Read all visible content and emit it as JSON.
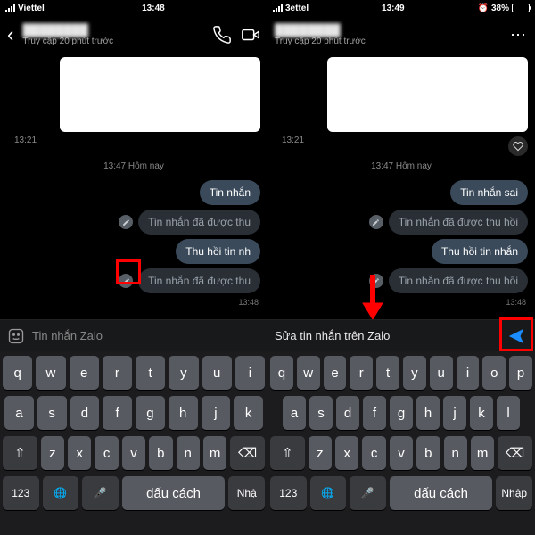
{
  "left": {
    "status": {
      "carrier": "Viettel",
      "time": "13:48"
    },
    "header": {
      "name": "████████",
      "sub": "Truy cập 20 phút trước"
    },
    "img_ts": "13:21",
    "center_ts": "13:47 Hôm nay",
    "msgs": [
      {
        "text": "Tin nhắn",
        "type": "normal"
      },
      {
        "text": "Tin nhắn đã được thu",
        "type": "recalled",
        "edit": true
      },
      {
        "text": "Thu hồi tin nh",
        "type": "normal"
      },
      {
        "text": "Tin nhắn đã được thu",
        "type": "recalled",
        "edit": true,
        "ts": "13:48"
      }
    ],
    "input": {
      "placeholder": "Tin nhắn Zalo"
    },
    "kb": {
      "r1": [
        "q",
        "w",
        "e",
        "r",
        "t",
        "y",
        "u",
        "i"
      ],
      "r2": [
        "a",
        "s",
        "d",
        "f",
        "g",
        "h",
        "j",
        "k"
      ],
      "r3": [
        "z",
        "x",
        "c",
        "v",
        "b",
        "n",
        "m"
      ],
      "num": "123",
      "space": "dấu cách",
      "ret": "Nhậ"
    }
  },
  "right": {
    "status": {
      "carrier": "3ettel",
      "time": "13:49",
      "batt": "38%"
    },
    "header": {
      "name": "████████",
      "sub": "Truy cập 20 phút trước"
    },
    "img_ts": "13:21",
    "center_ts": "13:47 Hôm nay",
    "msgs": [
      {
        "text": "Tin nhắn sai",
        "type": "normal"
      },
      {
        "text": "Tin nhắn đã được thu hồi",
        "type": "recalled",
        "edit": true
      },
      {
        "text": "Thu hồi tin nhắn",
        "type": "normal"
      },
      {
        "text": "Tin nhắn đã được thu hồi",
        "type": "recalled",
        "edit": true,
        "ts": "13:48"
      }
    ],
    "input": {
      "typed": "Sửa tin nhắn trên Zalo"
    },
    "kb": {
      "r1": [
        "q",
        "w",
        "e",
        "r",
        "t",
        "y",
        "u",
        "i",
        "o",
        "p"
      ],
      "r2": [
        "a",
        "s",
        "d",
        "f",
        "g",
        "h",
        "j",
        "k",
        "l"
      ],
      "r3": [
        "z",
        "x",
        "c",
        "v",
        "b",
        "n",
        "m"
      ],
      "num": "123",
      "space": "dấu cách",
      "ret": "Nhập"
    }
  }
}
